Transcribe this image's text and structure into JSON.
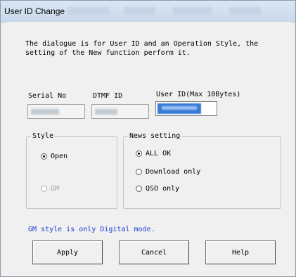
{
  "window": {
    "title": "User ID Change"
  },
  "description": "The dialogue is for User ID and an Operation Style, the\nsetting of the New function perform it.",
  "fields": {
    "serial_label": "Serial No",
    "dtmf_label": "DTMF ID",
    "userid_label": "User ID(Max 10Bytes)"
  },
  "style_group": {
    "legend": "Style",
    "open_label": "Open",
    "gm_label": "GM",
    "selected": "Open"
  },
  "news_group": {
    "legend": "News setting",
    "all_ok_label": "ALL OK",
    "download_only_label": "Download only",
    "qso_only_label": "QSO only",
    "selected": "ALL OK"
  },
  "note": "GM style is only Digital mode.",
  "buttons": {
    "apply": "Apply",
    "cancel": "Cancel",
    "help": "Help"
  },
  "colors": {
    "note_text": "#1f3fd1",
    "selection": "#3a7bd5",
    "titlebar": "#c9d9ec"
  }
}
